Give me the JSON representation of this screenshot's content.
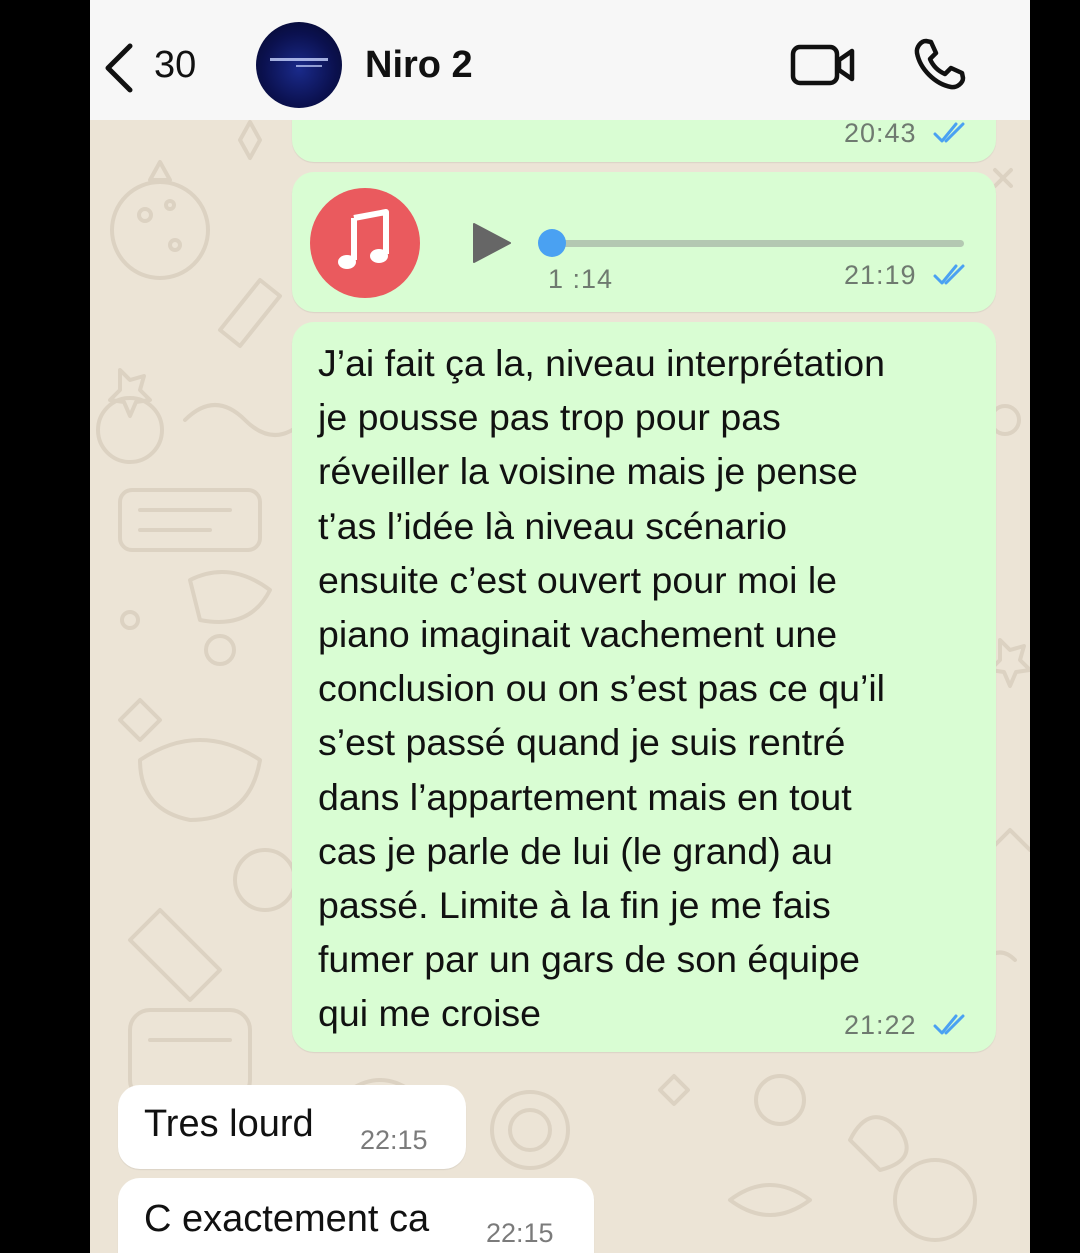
{
  "header": {
    "back_count": "30",
    "contact_name": "Niro 2"
  },
  "messages": [
    {
      "type": "outgoing-partial",
      "time": "20:43",
      "status": "read"
    },
    {
      "type": "outgoing-audio",
      "duration": "1 :14",
      "time": "21:19",
      "status": "read",
      "progress": 0.0
    },
    {
      "type": "outgoing-text",
      "lines": [
        "J’ai fait ça la, niveau interprétation",
        "je pousse pas trop pour pas",
        "réveiller la voisine mais je pense",
        "t’as l’idée là niveau scénario",
        "ensuite c’est ouvert pour moi le",
        "piano imaginait vachement une",
        "conclusion ou on s’est pas ce qu’il",
        "s’est passé quand je suis rentré",
        "dans l’appartement mais en tout",
        "cas je parle de lui (le grand) au",
        "passé. Limite à la fin je me fais",
        "fumer par un gars de son équipe",
        "qui me croise"
      ],
      "time": "21:22",
      "status": "read"
    },
    {
      "type": "incoming-text",
      "text": "Tres lourd",
      "time": "22:15"
    },
    {
      "type": "incoming-text",
      "text": "C exactement ca",
      "time": "22:15"
    }
  ],
  "colors": {
    "chat_background": "#ece4d6",
    "outgoing_bubble": "#d9fdd3",
    "incoming_bubble": "#ffffff",
    "read_ticks": "#4aa1f2",
    "music_icon": "#ea5a5e"
  },
  "icons": {
    "back": "chevron-left-icon",
    "video": "video-camera-icon",
    "call": "phone-icon",
    "music": "music-note-icon",
    "play": "play-icon",
    "status": "double-check-icon"
  }
}
